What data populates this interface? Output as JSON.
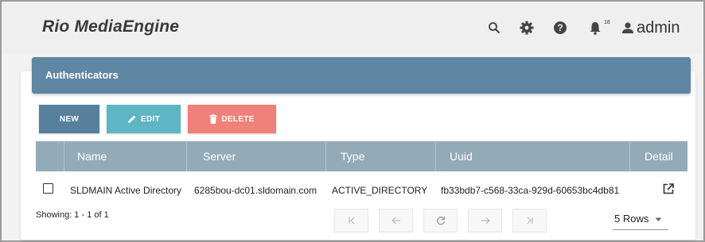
{
  "app": {
    "title": "Rio MediaEngine",
    "notification_count": "18",
    "user": "admin",
    "icons": [
      "search-icon",
      "gear-icon",
      "help-icon",
      "bell-icon",
      "user-icon"
    ]
  },
  "panel": {
    "title": "Authenticators"
  },
  "toolbar": {
    "new_label": "NEW",
    "edit_label": "EDIT",
    "delete_label": "DELETE",
    "colors": {
      "new": "#56809c",
      "edit": "#5eb5c3",
      "delete": "#f0807a"
    }
  },
  "table": {
    "columns": [
      "Name",
      "Server",
      "Type",
      "Uuid",
      "Detail"
    ],
    "rows": [
      {
        "name": "SLDMAIN Active Directory",
        "server": "6285bou-dc01.sldomain.com",
        "type": "ACTIVE_DIRECTORY",
        "uuid": "fb33bdb7-c568-33ca-929d-60653bc4db81"
      }
    ]
  },
  "footer": {
    "showing": "Showing: 1 - 1 of 1",
    "rows_per_page": "5 Rows",
    "pager_icons": [
      "first-page-icon",
      "prev-page-icon",
      "refresh-icon",
      "next-page-icon",
      "last-page-icon"
    ]
  }
}
